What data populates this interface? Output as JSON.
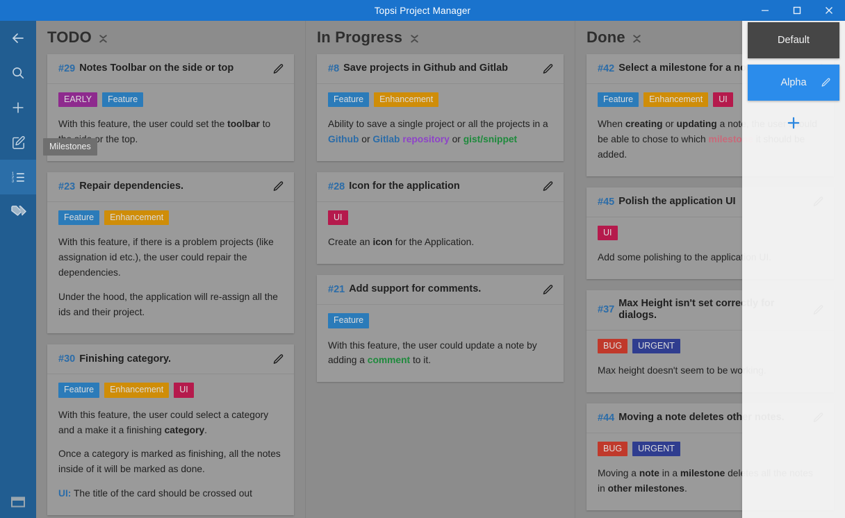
{
  "window": {
    "title": "Topsi Project Manager",
    "controls": [
      {
        "name": "minimize",
        "glyph": "—"
      },
      {
        "name": "maximize",
        "glyph": "□"
      },
      {
        "name": "close",
        "glyph": "✕"
      }
    ]
  },
  "sidebar": {
    "items": [
      {
        "name": "back",
        "icon": "back-arrow-icon",
        "active": false
      },
      {
        "name": "search",
        "icon": "search-icon",
        "active": false
      },
      {
        "name": "add",
        "icon": "plus-icon",
        "active": false
      },
      {
        "name": "notes",
        "icon": "edit-note-icon",
        "active": false
      },
      {
        "name": "milestones",
        "icon": "numbered-list-icon",
        "active": true
      },
      {
        "name": "tags",
        "icon": "tags-icon",
        "active": false
      }
    ],
    "bottom": {
      "name": "layout",
      "icon": "window-layout-icon"
    }
  },
  "tooltip": {
    "text": "Milestones"
  },
  "milestone_panel": {
    "items": [
      {
        "label": "Default",
        "color": "#464646",
        "selected": false,
        "editable": false
      },
      {
        "label": "Alpha",
        "color": "#2b8ceb",
        "selected": true,
        "editable": true
      }
    ],
    "add_label": "+"
  },
  "tag_colors": {
    "EARLY": "#8e2a8e",
    "Feature": "#2b7bb9",
    "Enhancement": "#cf8d08",
    "UI": "#b51a4c",
    "BUG": "#c0392b",
    "URGENT": "#2f3d8f"
  },
  "columns": [
    {
      "title": "TODO",
      "cards": [
        {
          "id": "#29",
          "title": "Notes Toolbar on the side or top",
          "tags": [
            "EARLY",
            "Feature"
          ],
          "paragraphs": [
            [
              {
                "t": "With this feature, the user could set the "
              },
              {
                "t": "toolbar",
                "b": true
              },
              {
                "t": " to the side or the top."
              }
            ]
          ]
        },
        {
          "id": "#23",
          "title": "Repair dependencies.",
          "tags": [
            "Feature",
            "Enhancement"
          ],
          "paragraphs": [
            [
              {
                "t": "With this feature, if there is a problem projects (like assignation id etc.), the user could repair the dependencies."
              }
            ],
            [
              {
                "t": "Under the hood, the application will re-assign all the ids and their project."
              }
            ]
          ]
        },
        {
          "id": "#30",
          "title": "Finishing category.",
          "tags": [
            "Feature",
            "Enhancement",
            "UI"
          ],
          "paragraphs": [
            [
              {
                "t": "With this feature, the user could select a category and a make it a finishing "
              },
              {
                "t": "category",
                "b": true
              },
              {
                "t": "."
              }
            ],
            [
              {
                "t": "Once a category is marked as finishing, all the notes inside of it will be marked as done."
              }
            ],
            [
              {
                "t": "UI:",
                "b": true,
                "c": "#2b6ca8"
              },
              {
                "t": " The title of the card should be crossed out"
              }
            ]
          ]
        }
      ]
    },
    {
      "title": "In Progress",
      "cards": [
        {
          "id": "#8",
          "title": "Save projects in Github and Gitlab",
          "tags": [
            "Feature",
            "Enhancement"
          ],
          "paragraphs": [
            [
              {
                "t": "Ability to save a single project or all the projects in a "
              },
              {
                "t": "Github",
                "b": true,
                "c": "#2b6ca8"
              },
              {
                "t": " or "
              },
              {
                "t": "Gitlab",
                "b": true,
                "c": "#2b6ca8"
              },
              {
                "t": " "
              },
              {
                "t": "repository",
                "b": true,
                "c": "#8e44c8"
              },
              {
                "t": " or "
              },
              {
                "t": "gist/snippet",
                "b": true,
                "c": "#1e8a3c"
              }
            ]
          ]
        },
        {
          "id": "#28",
          "title": "Icon for the application",
          "tags": [
            "UI"
          ],
          "paragraphs": [
            [
              {
                "t": "Create an "
              },
              {
                "t": "icon",
                "b": true
              },
              {
                "t": " for the Application."
              }
            ]
          ]
        },
        {
          "id": "#21",
          "title": "Add support for comments.",
          "tags": [
            "Feature"
          ],
          "paragraphs": [
            [
              {
                "t": "With this feature, the user could update a note by adding a "
              },
              {
                "t": "comment",
                "b": true,
                "c": "#1e8a3c"
              },
              {
                "t": " to it."
              }
            ]
          ]
        }
      ]
    },
    {
      "title": "Done",
      "cards": [
        {
          "id": "#42",
          "title": "Select a milestone for a note.",
          "tags": [
            "Feature",
            "Enhancement",
            "UI"
          ],
          "paragraphs": [
            [
              {
                "t": "When "
              },
              {
                "t": "creating",
                "b": true
              },
              {
                "t": " or "
              },
              {
                "t": "updating",
                "b": true
              },
              {
                "t": " a note, the user should be able to chose to which "
              },
              {
                "t": "milestone",
                "b": true,
                "c": "#c96a7a"
              },
              {
                "t": " it should be added."
              }
            ]
          ]
        },
        {
          "id": "#45",
          "title": "Polish the application UI",
          "tags": [
            "UI"
          ],
          "paragraphs": [
            [
              {
                "t": "Add some polishing to the application UI."
              }
            ]
          ]
        },
        {
          "id": "#37",
          "title": "Max Height isn't set correctly for dialogs.",
          "tags": [
            "BUG",
            "URGENT"
          ],
          "paragraphs": [
            [
              {
                "t": "Max height doesn't seem to be working."
              }
            ]
          ]
        },
        {
          "id": "#44",
          "title": "Moving a note deletes other notes.",
          "tags": [
            "BUG",
            "URGENT"
          ],
          "paragraphs": [
            [
              {
                "t": "Moving a "
              },
              {
                "t": "note",
                "b": true
              },
              {
                "t": " in a "
              },
              {
                "t": "milestone",
                "b": true
              },
              {
                "t": " deletes all the notes in "
              },
              {
                "t": "other milestones",
                "b": true
              },
              {
                "t": "."
              }
            ]
          ]
        }
      ]
    }
  ]
}
